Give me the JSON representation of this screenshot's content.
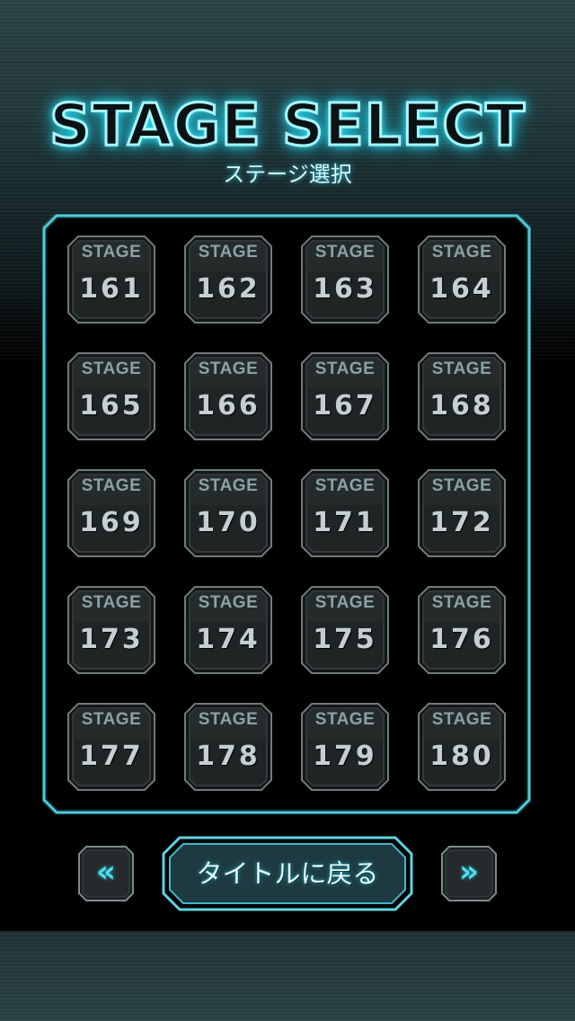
{
  "header": {
    "title": "STAGE SELECT",
    "subtitle": "ステージ選択"
  },
  "stages": [
    {
      "label": "STAGE",
      "number": "161"
    },
    {
      "label": "STAGE",
      "number": "162"
    },
    {
      "label": "STAGE",
      "number": "163"
    },
    {
      "label": "STAGE",
      "number": "164"
    },
    {
      "label": "STAGE",
      "number": "165"
    },
    {
      "label": "STAGE",
      "number": "166"
    },
    {
      "label": "STAGE",
      "number": "167"
    },
    {
      "label": "STAGE",
      "number": "168"
    },
    {
      "label": "STAGE",
      "number": "169"
    },
    {
      "label": "STAGE",
      "number": "170"
    },
    {
      "label": "STAGE",
      "number": "171"
    },
    {
      "label": "STAGE",
      "number": "172"
    },
    {
      "label": "STAGE",
      "number": "173"
    },
    {
      "label": "STAGE",
      "number": "174"
    },
    {
      "label": "STAGE",
      "number": "175"
    },
    {
      "label": "STAGE",
      "number": "176"
    },
    {
      "label": "STAGE",
      "number": "177"
    },
    {
      "label": "STAGE",
      "number": "178"
    },
    {
      "label": "STAGE",
      "number": "179"
    },
    {
      "label": "STAGE",
      "number": "180"
    }
  ],
  "footer": {
    "prev_glyph": "«",
    "next_glyph": "»",
    "back_to_title_label": "タイトルに戻る",
    "prev_icon": "double-chevron-left-icon",
    "next_icon": "double-chevron-right-icon"
  },
  "colors": {
    "accent": "#4fdcea",
    "panel_border": "#5fd3df",
    "button_fill": "#1b1f20"
  }
}
